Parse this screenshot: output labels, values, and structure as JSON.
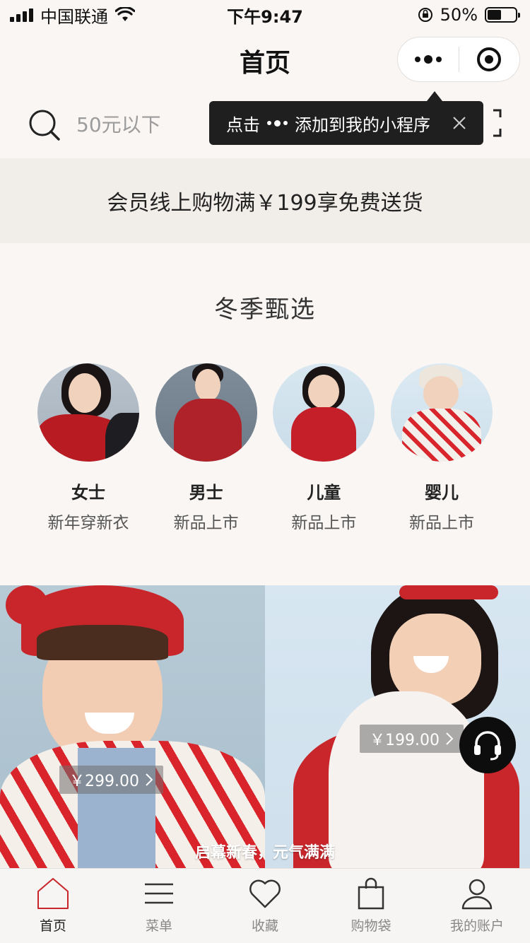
{
  "status_bar": {
    "carrier": "中国联通",
    "time": "下午9:47",
    "battery": "50%"
  },
  "navbar": {
    "title": "首页"
  },
  "search": {
    "placeholder": "50元以下"
  },
  "tooltip": {
    "prefix": "点击",
    "suffix": "添加到我的小程序"
  },
  "promo": {
    "text": "会员线上购物满￥199享免费送货"
  },
  "section": {
    "title": "冬季甄选",
    "categories": [
      {
        "name": "女士",
        "sub": "新年穿新衣"
      },
      {
        "name": "男士",
        "sub": "新品上市"
      },
      {
        "name": "儿童",
        "sub": "新品上市"
      },
      {
        "name": "婴儿",
        "sub": "新品上市"
      }
    ]
  },
  "hero": {
    "left_price": "￥299.00",
    "right_price": "￥199.00",
    "caption": "启幕新春，元气满满"
  },
  "tabbar": {
    "items": [
      {
        "label": "首页",
        "icon": "home-icon",
        "active": true
      },
      {
        "label": "菜单",
        "icon": "menu-icon",
        "active": false
      },
      {
        "label": "收藏",
        "icon": "heart-icon",
        "active": false
      },
      {
        "label": "购物袋",
        "icon": "bag-icon",
        "active": false
      },
      {
        "label": "我的账户",
        "icon": "user-icon",
        "active": false
      }
    ]
  },
  "colors": {
    "background": "#f9f6f4",
    "promo_bg": "#f1ede9",
    "accent_red": "#c8262b",
    "tooltip_bg": "#1f1f1f"
  }
}
